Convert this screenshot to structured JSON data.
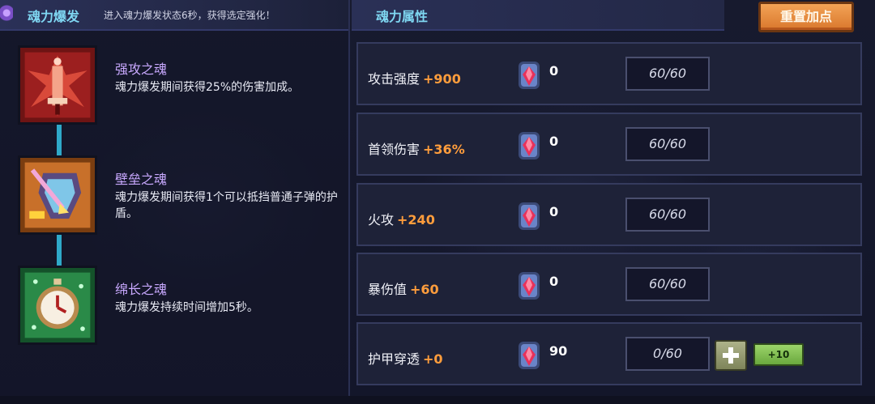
{
  "soul_burst": {
    "title": "魂力爆发",
    "description": "进入魂力爆发状态6秒，获得选定强化！",
    "skills": [
      {
        "name": "强攻之魂",
        "text": "魂力爆发期间获得25%的伤害加成。",
        "icon": "demon-sword-icon"
      },
      {
        "name": "壁垒之魂",
        "text": "魂力爆发期间获得1个可以抵挡普通子弹的护盾。",
        "icon": "shield-arrow-icon"
      },
      {
        "name": "绵长之魂",
        "text": "魂力爆发持续时间增加5秒。",
        "icon": "stopwatch-icon"
      }
    ]
  },
  "attributes": {
    "title": "魂力属性",
    "reset_label": "重置加点",
    "gem_icon": "soul-crystal-icon",
    "rows": [
      {
        "label": "攻击强度",
        "bonus": "+900",
        "gems": "0",
        "progress": "60/60"
      },
      {
        "label": "首领伤害",
        "bonus": "+36%",
        "gems": "0",
        "progress": "60/60"
      },
      {
        "label": "火攻",
        "bonus": "+240",
        "gems": "0",
        "progress": "60/60"
      },
      {
        "label": "暴伤值",
        "bonus": "+60",
        "gems": "0",
        "progress": "60/60"
      },
      {
        "label": "护甲穿透",
        "bonus": "+0",
        "gems": "90",
        "progress": "0/60",
        "add10_label": "+10"
      }
    ]
  },
  "colors": {
    "title": "#7fd7f2",
    "skill_name": "#c9a9ff",
    "bonus": "#ff9d3c",
    "reset_button": "#e88a3e",
    "add_button": "#8bc55a"
  }
}
